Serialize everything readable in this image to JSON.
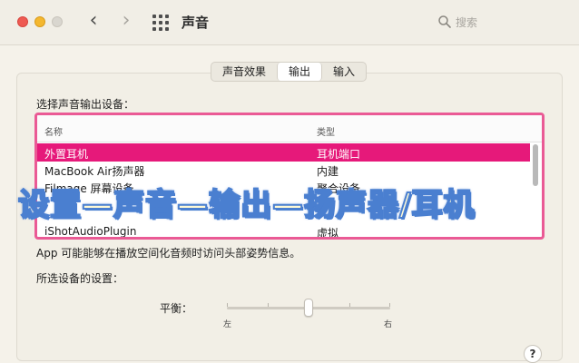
{
  "window": {
    "title": "声音",
    "nav_back": "‹",
    "nav_forward": "›"
  },
  "search": {
    "placeholder": "搜索"
  },
  "tabs": [
    {
      "label": "声音效果",
      "active": false
    },
    {
      "label": "输出",
      "active": true
    },
    {
      "label": "输入",
      "active": false
    }
  ],
  "output": {
    "section_label": "选择声音输出设备：",
    "columns": [
      "名称",
      "类型"
    ],
    "devices": [
      {
        "name": "外置耳机",
        "type": "耳机端口",
        "selected": true
      },
      {
        "name": "MacBook Air扬声器",
        "type": "内建",
        "selected": false
      },
      {
        "name": "Filmage 屏幕设备",
        "type": "聚合设备",
        "selected": false
      },
      {
        "name": "",
        "type": "",
        "selected": false
      },
      {
        "name": "iShotAudioPlugin",
        "type": "虚拟",
        "selected": false
      }
    ],
    "info_text": "App 可能能够在播放空间化音频时访问头部姿势信息。"
  },
  "overlay_banner": "设置—声音—输出—扬声器/耳机",
  "device_settings": {
    "section_label": "所选设备的设置：",
    "balance_label": "平衡：",
    "balance_left": "左",
    "balance_right": "右",
    "balance_value": 0.5
  },
  "help_label": "?",
  "colors": {
    "accent_pink": "#e6197a",
    "table_border": "#ea5a95",
    "banner_fill": "#fdf9d6",
    "banner_stroke": "#4a7fd0"
  }
}
